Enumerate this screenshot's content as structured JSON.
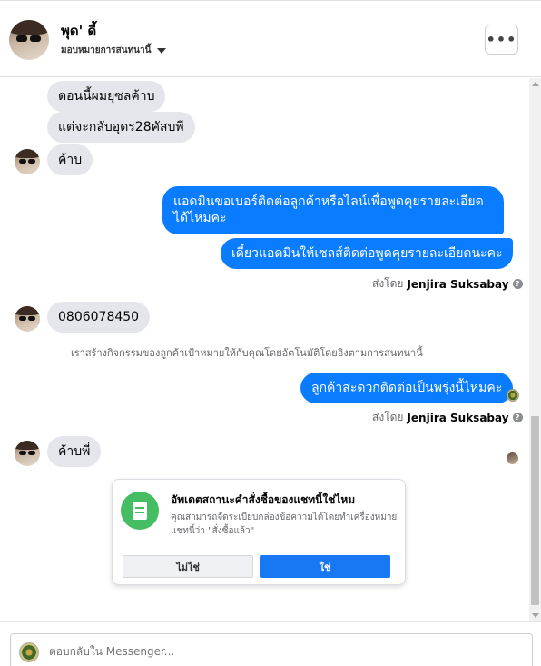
{
  "header": {
    "name": "พุด' ดี้",
    "subtitle": "มอบหมายการสนทนานี้",
    "more_label": "•••"
  },
  "messages": {
    "incoming_1": "ตอนนี้ผมยุซลค้าบ",
    "incoming_2": "แต่จะกลับอุดร28คัสบพี",
    "incoming_3": "ค้าบ",
    "outgoing_1": "แอดมินขอเบอร์ติดต่อลูกค้าหรือไลน์เพื่อพูดคุยรายละเอียดได้ไหมคะ",
    "outgoing_2": "เดี๋ยวแอดมินให้เซลส์ติดต่อพูดคุยรายละเอียดนะคะ",
    "sent_by_1_prefix": "ส่งโดย",
    "sent_by_1_name": "Jenjira Suksabay",
    "incoming_4": "0806078450",
    "notice": "เราสร้างกิจกรรมของลูกค้าเป้าหมายให้กับคุณโดยอัตโนมัติโดยอิงตามการสนทนานี้",
    "outgoing_3": "ลูกค้าสะดวกติดต่อเป็นพรุ่งนี้ไหมคะ",
    "sent_by_2_prefix": "ส่งโดย",
    "sent_by_2_name": "Jenjira Suksabay",
    "incoming_5": "ค้าบพี่"
  },
  "card": {
    "title": "อัพเดตสถานะคำสั่งซื้อของแชทนี้ใช่ไหม",
    "body": "คุณสามารถจัดระเบียบกล่องข้อความได้โดยทำเครื่องหมายแชทนี้ว่า \"สั่งซื้อแล้ว\"",
    "no_label": "ไม่ใช่",
    "yes_label": "ใช่"
  },
  "composer": {
    "placeholder": "ตอบกลับใน Messenger..."
  },
  "colors": {
    "outgoing_bubble": "#0a7cff",
    "incoming_bubble": "#e4e6eb",
    "primary_button": "#1877f2",
    "card_icon": "#45bd62"
  }
}
